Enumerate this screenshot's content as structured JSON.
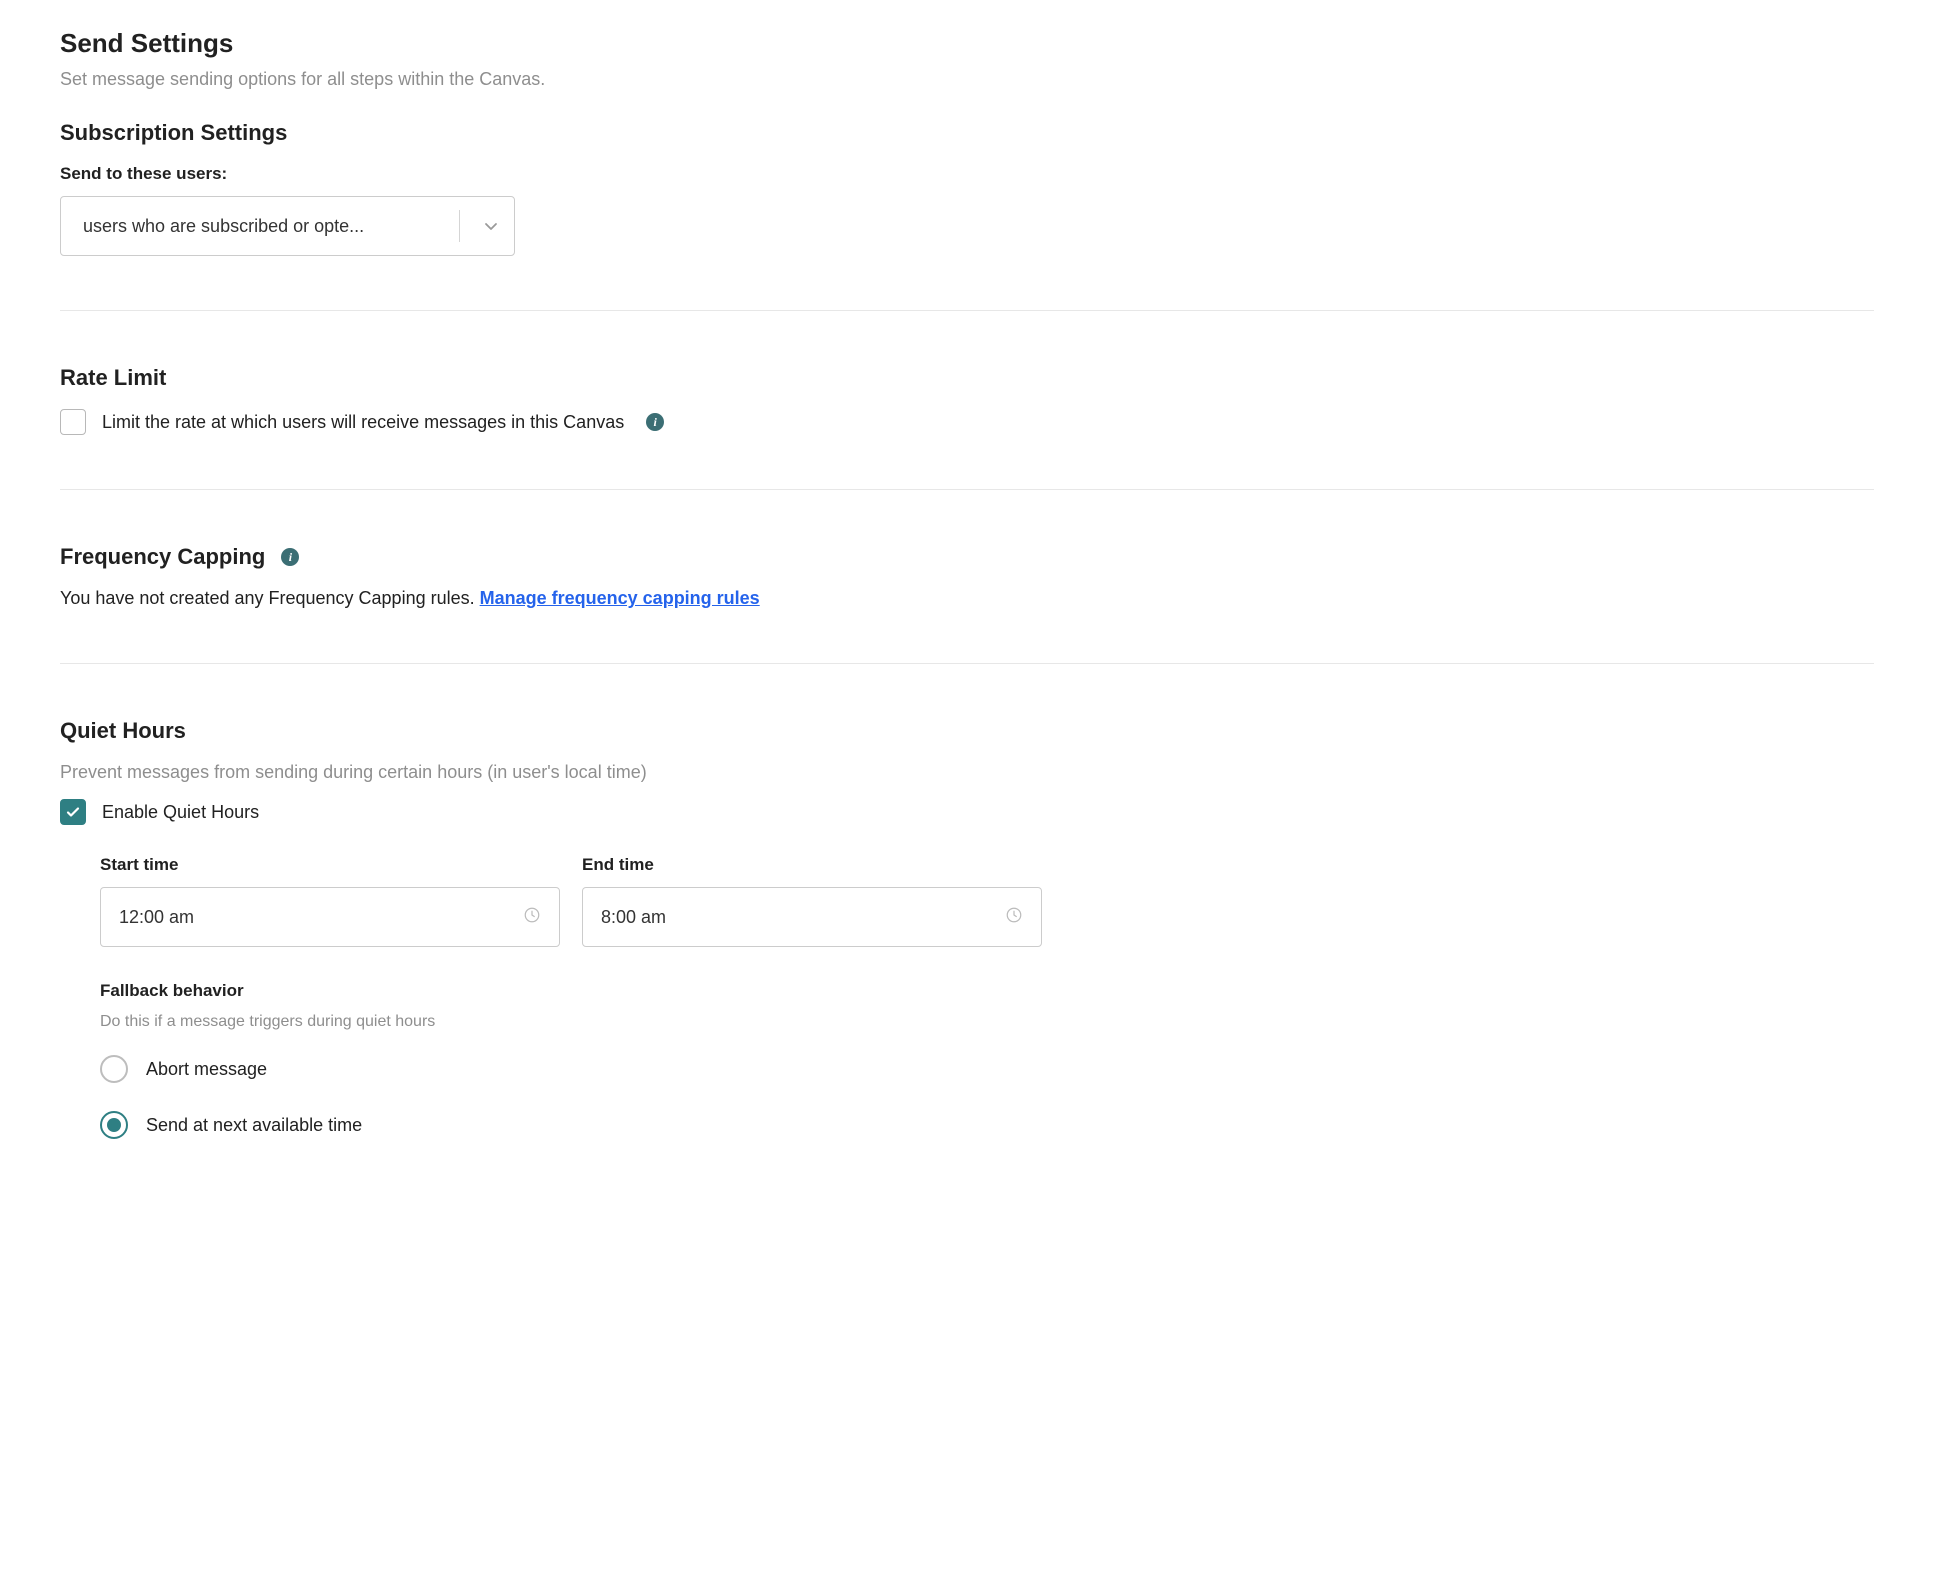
{
  "sendSettings": {
    "title": "Send Settings",
    "subtitle": "Set message sending options for all steps within the Canvas."
  },
  "subscriptionSettings": {
    "title": "Subscription Settings",
    "fieldLabel": "Send to these users:",
    "selectedValue": "users who are subscribed or opte..."
  },
  "rateLimit": {
    "title": "Rate Limit",
    "checkboxLabel": "Limit the rate at which users will receive messages in this Canvas",
    "checked": false
  },
  "frequencyCapping": {
    "title": "Frequency Capping",
    "bodyText": "You have not created any Frequency Capping rules.",
    "linkText": "Manage frequency capping rules"
  },
  "quietHours": {
    "title": "Quiet Hours",
    "subtitle": "Prevent messages from sending during certain hours (in user's local time)",
    "enableLabel": "Enable Quiet Hours",
    "enabled": true,
    "startLabel": "Start time",
    "startValue": "12:00 am",
    "endLabel": "End time",
    "endValue": "8:00 am",
    "fallback": {
      "title": "Fallback behavior",
      "subtitle": "Do this if a message triggers during quiet hours",
      "options": {
        "abort": "Abort message",
        "sendNext": "Send at next available time"
      },
      "selected": "sendNext"
    }
  },
  "icons": {
    "info": "i"
  }
}
